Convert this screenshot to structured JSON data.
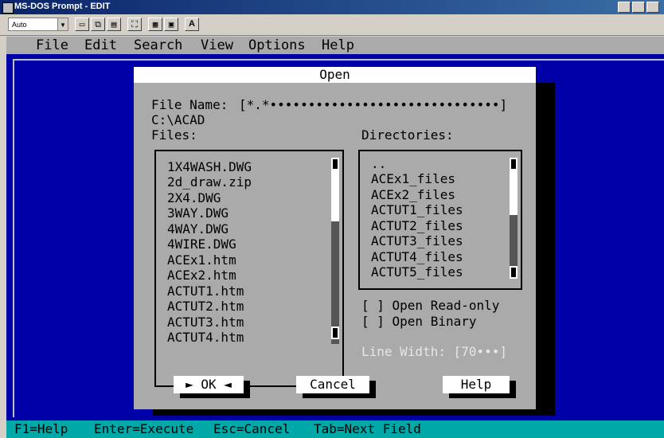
{
  "window": {
    "title": "MS-DOS Prompt - EDIT"
  },
  "toolbar": {
    "font_size": "Auto",
    "font_button": "A"
  },
  "menu": [
    "File",
    "Edit",
    "Search",
    "View",
    "Options",
    "Help"
  ],
  "dialog": {
    "title": "Open",
    "file_name_label": "File Name:",
    "file_name_value": "[*.*••••••••••••••••••••••••••••••]",
    "path": "C:\\ACAD",
    "files_label": "Files:",
    "directories_label": "Directories:",
    "files": [
      "1X4WASH.DWG",
      "2d_draw.zip",
      "2X4.DWG",
      "3WAY.DWG",
      "4WAY.DWG",
      "4WIRE.DWG",
      "ACEx1.htm",
      "ACEx2.htm",
      "ACTUT1.htm",
      "ACTUT2.htm",
      "ACTUT3.htm",
      "ACTUT4.htm"
    ],
    "directories": [
      "..",
      "ACEx1_files",
      "ACEx2_files",
      "ACTUT1_files",
      "ACTUT2_files",
      "ACTUT3_files",
      "ACTUT4_files",
      "ACTUT5_files"
    ],
    "open_readonly": "[ ] Open Read-only",
    "open_binary": "[ ] Open Binary",
    "line_width": "Line Width: [70•••]",
    "ok": "► OK ◄",
    "cancel": "Cancel",
    "help": "Help"
  },
  "statusbar": {
    "f1": "F1=Help",
    "enter": "Enter=Execute",
    "esc": "Esc=Cancel",
    "tab": "Tab=Next Field"
  }
}
